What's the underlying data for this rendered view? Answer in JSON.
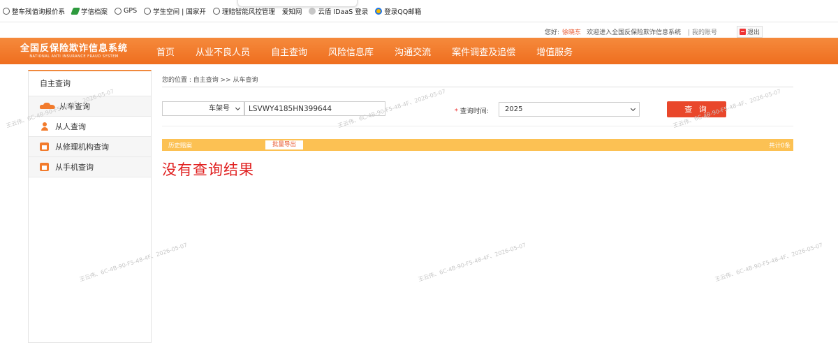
{
  "bookmarks": [
    {
      "label": "整车残值询报价系",
      "icon": "globe-icon"
    },
    {
      "label": "学信档案",
      "icon": "leaf-icon"
    },
    {
      "label": "GPS",
      "icon": "globe-icon"
    },
    {
      "label": "学生空间 | 国家开",
      "icon": "globe-icon"
    },
    {
      "label": "理赔智能风控管理",
      "icon": "globe-icon"
    },
    {
      "label": "爱知网",
      "icon": ""
    },
    {
      "label": "云盾 IDaaS 登录",
      "icon": "cloud-icon"
    },
    {
      "label": "登录QQ邮箱",
      "icon": "qq-mail-icon"
    }
  ],
  "userbar": {
    "greeting": "您好:",
    "username": "徐晓东",
    "welcome": "欢迎进入全国反保险欺诈信息系统",
    "account": "| 我的账号",
    "logout": "退出"
  },
  "logo": {
    "cn": "全国反保险欺诈信息系统",
    "en": "NATIONAL ANTI INSURANCE FRAUD SYSTEM"
  },
  "nav": [
    "首页",
    "从业不良人员",
    "自主查询",
    "风险信息库",
    "沟通交流",
    "案件调查及追偿",
    "增值服务"
  ],
  "sidebar": {
    "title": "自主查询",
    "items": [
      {
        "label": "从车查询",
        "icon": "car-icon"
      },
      {
        "label": "从人查询",
        "icon": "person-icon"
      },
      {
        "label": "从修理机构查询",
        "icon": "calendar-icon"
      },
      {
        "label": "从手机查询",
        "icon": "calendar-icon"
      }
    ]
  },
  "main": {
    "breadcrumb": "您的位置 : 自主查询 >> 从车查询",
    "search_type": "车架号",
    "vin": "LSVWY4185HN399644",
    "time_label": "查询时间:",
    "time_required": "*",
    "time_value": "2025",
    "query_button": "查 询",
    "history_label": "历史赔案",
    "export_button": "批量导出",
    "total": "共计0条",
    "no_result": "没有查询结果"
  },
  "watermark": "王云伟、6C-4B-90-F5-48-4F、2026-05-07",
  "colors": {
    "nav_orange": "#f07a2a",
    "result_bar": "#fcc153",
    "query_button": "#e9472b",
    "no_result_text": "#e02020"
  }
}
